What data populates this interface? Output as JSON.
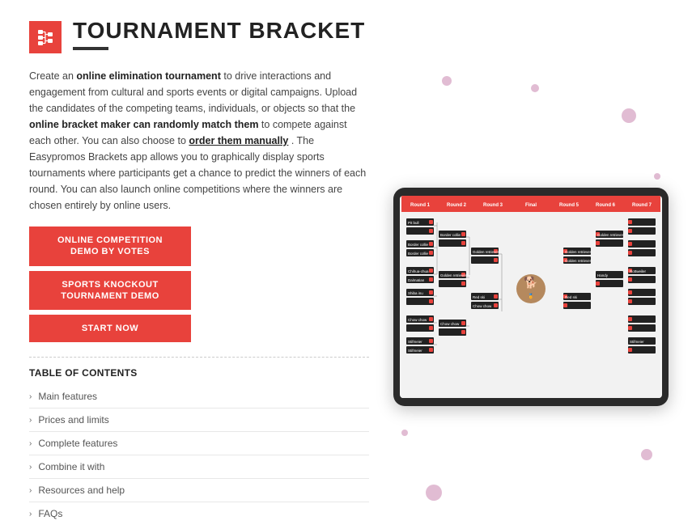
{
  "header": {
    "title": "TOURNAMENT BRACKET",
    "logo_alt": "tournament-icon"
  },
  "description": {
    "part1": "Create an ",
    "bold1": "online elimination tournament",
    "part2": " to drive interactions and engagement from cultural and sports events or digital campaigns. Upload the candidates of the competing teams, individuals, or objects so that the ",
    "bold2": "online bracket maker can randomly match them",
    "part3": " to compete against each other. You can also choose to ",
    "underline1": "order them manually",
    "part4": ". The Easypromos Brackets app allows you to graphically display sports tournaments where participants get a chance to predict the winners of each round. You can also launch online competitions where the winners are chosen entirely by online users."
  },
  "buttons": [
    {
      "label": "ONLINE COMPETITION\nDEMO BY VOTES"
    },
    {
      "label": "SPORTS KNOCKOUT\nTOURNAMENT DEMO"
    },
    {
      "label": "START NOW"
    }
  ],
  "toc": {
    "title": "TABLE OF CONTENTS",
    "items": [
      "Main features",
      "Prices and limits",
      "Complete features",
      "Combine it with",
      "Resources and help",
      "FAQs"
    ]
  },
  "bracket": {
    "rounds": [
      "Round 1",
      "Round 2",
      "Round 3",
      "Final",
      "Round 5",
      "Round 6",
      "Round 7"
    ]
  },
  "colors": {
    "accent": "#e8423c",
    "dot": "#d4a0c0"
  }
}
